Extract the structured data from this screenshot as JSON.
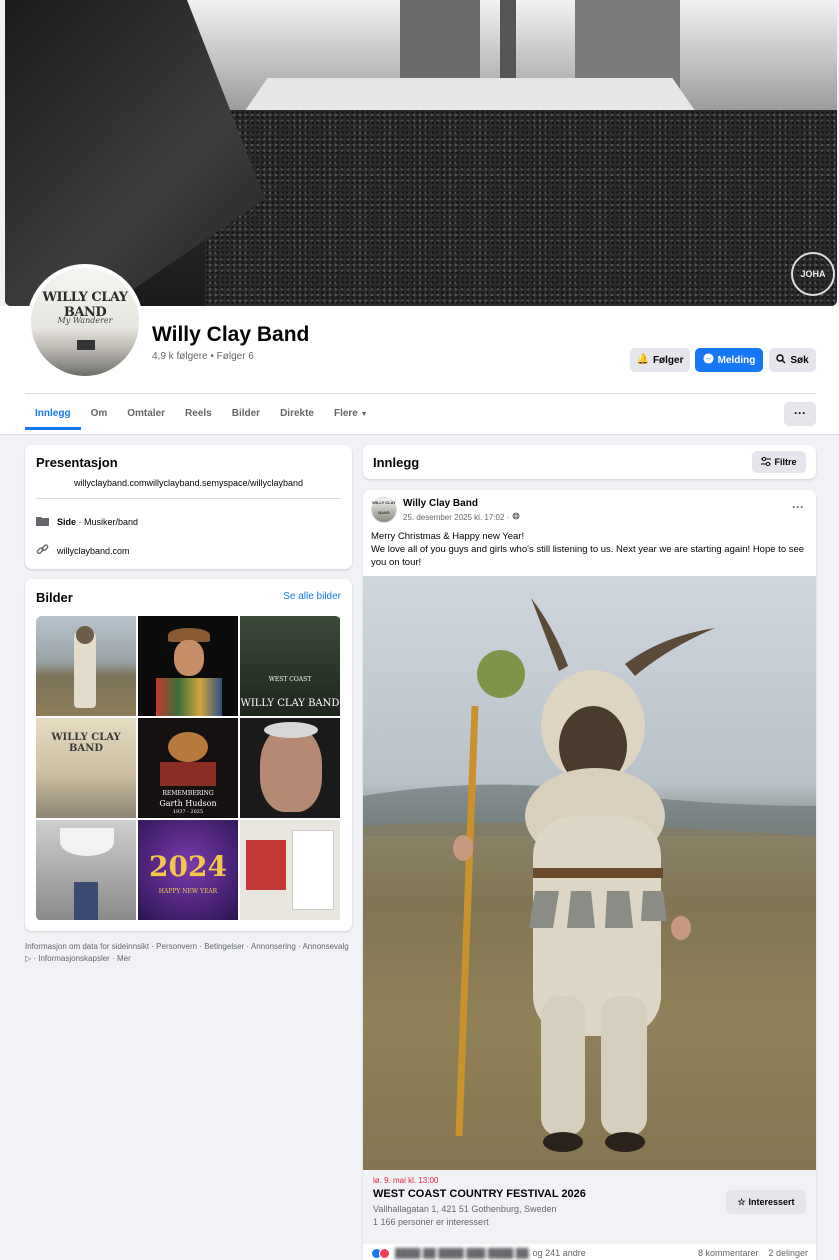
{
  "page": {
    "name": "Willy Clay Band",
    "stats": "4,9 k følgere • Følger 6",
    "avatar_title": "WILLY CLAY BAND",
    "avatar_subtitle": "My Wanderer",
    "cover_badge": "JOHA"
  },
  "actions": {
    "follow": "Følger",
    "message": "Melding",
    "search": "Søk"
  },
  "tabs": [
    {
      "label": "Innlegg",
      "active": true
    },
    {
      "label": "Om"
    },
    {
      "label": "Omtaler"
    },
    {
      "label": "Reels"
    },
    {
      "label": "Bilder"
    },
    {
      "label": "Direkte"
    },
    {
      "label": "Flere"
    }
  ],
  "more_menu": "···",
  "intro": {
    "title": "Presentasjon",
    "bio": "willyclayband.comwillyclayband.semyspace/willyclayband",
    "category_prefix": "Side",
    "category": " · Musiker/band",
    "website": "willyclayband.com"
  },
  "photos": {
    "title": "Bilder",
    "see_all": "Se alle bilder",
    "captions": {
      "p3": "WILLY CLAY BAND",
      "p3_top": "WEST COAST",
      "p4": "WILLY CLAY BAND",
      "p5_a": "REMEMBERING",
      "p5_b": "Garth Hudson",
      "p5_c": "1937 - 2025",
      "p8": "2024",
      "p8_b": "HAPPY NEW YEAR"
    }
  },
  "footer": "Informasjon om data for sideinnsikt · Personvern · Betingelser · Annonsering · Annonsevalg ▷ · Informasjonskapsler · Mer",
  "feed": {
    "title": "Innlegg",
    "filter": "Filtre"
  },
  "post": {
    "author": "Willy Clay Band",
    "time": "25. desember 2025 kl. 17:02 · ",
    "text_line1": "Merry Christmas & Happy new Year!",
    "text_line2": "We love all of you guys and girls who's still listening to us. Next year we are starting again! Hope to see you on tour!",
    "event": {
      "date": "lø. 9. mai kl. 13:00",
      "title": "WEST COAST COUNTRY FESTIVAL 2026",
      "location": "Vallhallagatan 1, 421 51 Gothenburg, Sweden",
      "interested_count": "1 166 personer er interessert",
      "interested_button": "Interessert"
    },
    "reactions": "og 241 andre",
    "comments": "8 kommentarer",
    "shares": "2 delinger"
  },
  "colors": {
    "accent": "#1877f2",
    "background": "#f0f2f5",
    "event_date": "#e41e3f"
  }
}
